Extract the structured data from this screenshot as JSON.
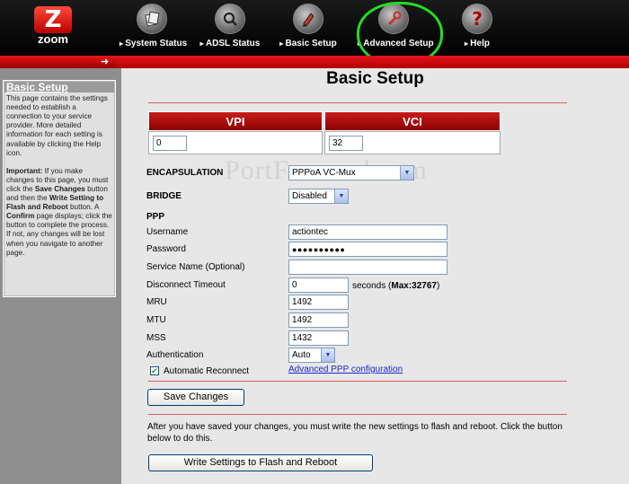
{
  "header": {
    "logo_text": "zoom",
    "nav": [
      {
        "label": "System Status",
        "icon": "status-icon"
      },
      {
        "label": "ADSL Status",
        "icon": "magnifier-icon"
      },
      {
        "label": "Basic Setup",
        "icon": "pencil-icon"
      },
      {
        "label": "Advanced Setup",
        "icon": "wrench-icon"
      },
      {
        "label": "Help",
        "icon": "question-icon"
      }
    ],
    "highlight_color": "#22dd22"
  },
  "sidebar": {
    "title": "Basic Setup",
    "p1": "This page contains the settings needed to establish a connection to your service provider. More detailed information for each setting is available by clicking the Help icon.",
    "important_label": "Important:",
    "p2a": " If you make changes to this page, you must click the ",
    "save_bold": "Save Changes",
    "p2b": " button and then the ",
    "write_bold": "Write Setting to Flash and Reboot",
    "p2c": " button. A ",
    "confirm_bold": "Confirm",
    "p2d": " page displays; click the button to complete the process. If not, any changes will be lost when you navigate to another page."
  },
  "main": {
    "title": "Basic Setup",
    "watermark": "PortForward.com",
    "vpi_label": "VPI",
    "vpi_value": "0",
    "vci_label": "VCI",
    "vci_value": "32",
    "encapsulation_label": "ENCAPSULATION",
    "encapsulation_value": "PPPoA VC-Mux",
    "bridge_label": "BRIDGE",
    "bridge_value": "Disabled",
    "ppp_label": "PPP",
    "username_label": "Username",
    "username_value": "actiontec",
    "password_label": "Password",
    "password_value": "●●●●●●●●●●",
    "service_label": "Service Name (Optional)",
    "service_value": "",
    "timeout_label": "Disconnect Timeout",
    "timeout_value": "0",
    "timeout_suffix": "seconds",
    "timeout_max_prefix": "(",
    "timeout_max": "Max:32767",
    "timeout_max_suffix": ")",
    "mru_label": "MRU",
    "mru_value": "1492",
    "mtu_label": "MTU",
    "mtu_value": "1492",
    "mss_label": "MSS",
    "mss_value": "1432",
    "auth_label": "Authentication",
    "auth_value": "Auto",
    "auto_reconnect_label": "Automatic Reconnect",
    "auto_reconnect_checked": true,
    "advanced_ppp_link": "Advanced PPP configuration",
    "save_button": "Save Changes",
    "note": "After you have saved your changes, you must write the new settings to flash and reboot. Click the button below to do this.",
    "write_button": "Write Settings to Flash and Reboot"
  }
}
